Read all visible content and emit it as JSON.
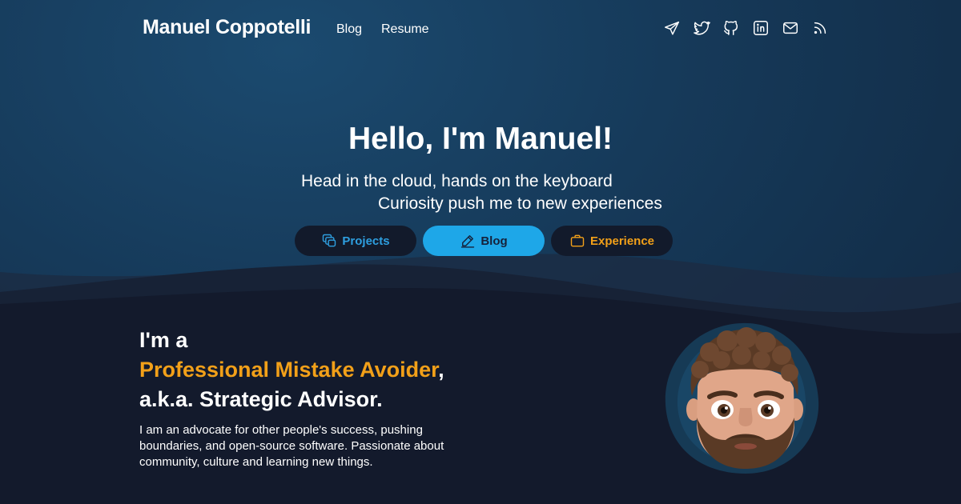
{
  "header": {
    "brand": "Manuel Coppotelli",
    "nav": {
      "blog": "Blog",
      "resume": "Resume"
    },
    "social_icons": [
      "telegram-icon",
      "twitter-icon",
      "github-icon",
      "linkedin-icon",
      "mail-icon",
      "rss-icon"
    ]
  },
  "hero": {
    "title": "Hello, I'm Manuel!",
    "tagline_1": "Head in the cloud, hands on the keyboard",
    "tagline_2": "Curiosity push me to new experiences",
    "buttons": {
      "projects": "Projects",
      "blog": "Blog",
      "experience": "Experience"
    }
  },
  "about": {
    "line1": "I'm a",
    "highlight": "Professional Mistake Avoider",
    "comma": ",",
    "line3": "a.k.a. Strategic Advisor.",
    "description": "I am an advocate for other people's success, pushing boundaries, and open-source software. Passionate about community, culture and learning new things."
  },
  "colors": {
    "accent_blue": "#1ea7e8",
    "accent_orange": "#f2a019",
    "dark_bg": "#131a2c"
  }
}
